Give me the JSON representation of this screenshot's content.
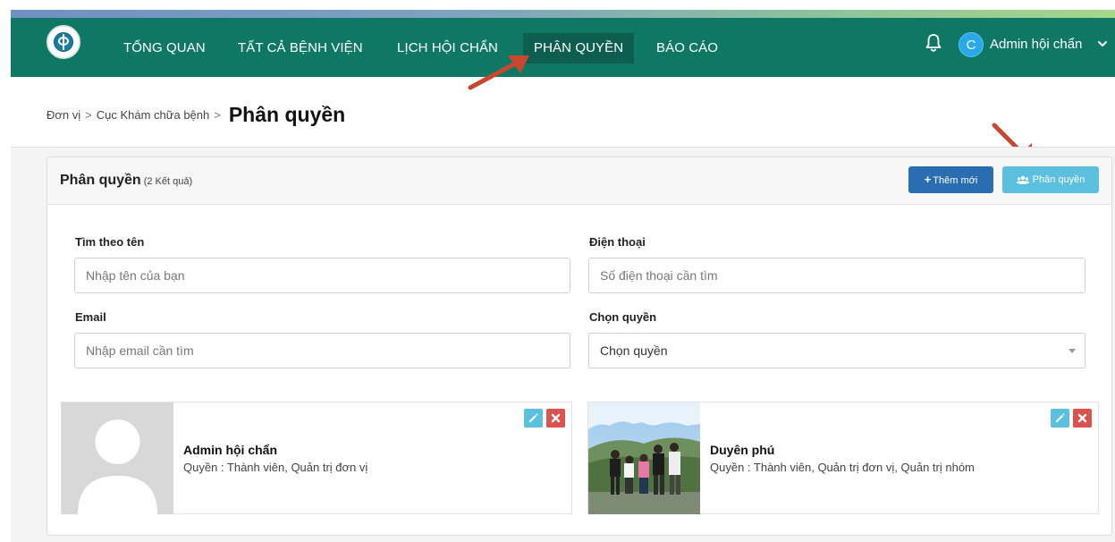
{
  "nav": {
    "items": [
      "TỔNG QUAN",
      "TẤT CẢ BỆNH VIỆN",
      "LỊCH HỘI CHẨN",
      "PHÂN QUYỀN",
      "BÁO CÁO"
    ],
    "active": "PHÂN QUYỀN",
    "user_initial": "C",
    "user_name": "Admin hội chẩn",
    "icons": {
      "notification": "bell-icon",
      "menu": "chevron-down-icon",
      "logo": "ministry-of-health-logo"
    }
  },
  "breadcrumb": {
    "items": [
      "Đơn vị",
      "Cục Khám chữa bệnh"
    ],
    "separator": ">",
    "current": "Phân quyền"
  },
  "panel": {
    "title": "Phân quyền",
    "count": "(2 Kết quả)",
    "add_label": "Thêm mới",
    "permission_label": "Phân quyền"
  },
  "filters": {
    "name": {
      "label": "Tìm theo tên",
      "placeholder": "Nhập tên của bạn"
    },
    "phone": {
      "label": "Điện thoại",
      "placeholder": "Số điện thoại cần tìm"
    },
    "email": {
      "label": "Email",
      "placeholder": "Nhập email cần tìm"
    },
    "role": {
      "label": "Chọn quyền",
      "value": "Chọn quyền"
    }
  },
  "users": [
    {
      "name": "Admin hội chẩn",
      "role": "Quyền : Thành viên, Quản trị đơn vị"
    },
    {
      "name": "Duyên phú",
      "role": "Quyền : Thành viên, Quản trị đơn vị, Quản trị nhóm"
    }
  ],
  "colors": {
    "navbar": "#0f7864",
    "nav_active": "#0d5e4e",
    "btn_primary": "#2a6db0",
    "btn_info": "#5bc0de",
    "btn_danger": "#d9534f",
    "annotation_arrow": "#c9462f"
  }
}
